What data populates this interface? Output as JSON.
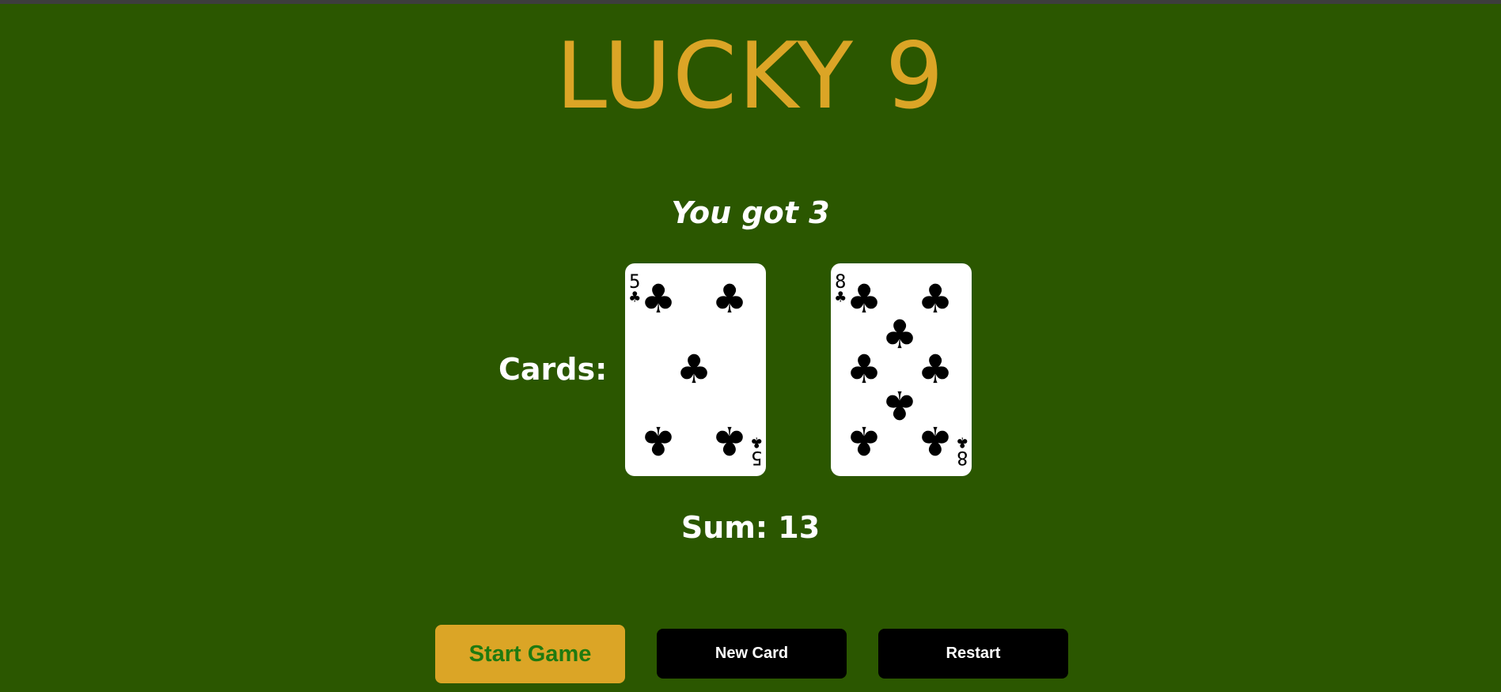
{
  "game": {
    "title": "LUCKY 9",
    "message": "You got 3",
    "cards_label": "Cards:",
    "sum_text": "Sum: 13"
  },
  "cards": [
    {
      "rank": "5",
      "suit": "clubs",
      "suit_glyph": "♣"
    },
    {
      "rank": "8",
      "suit": "clubs",
      "suit_glyph": "♣"
    }
  ],
  "buttons": {
    "start": "Start Game",
    "new_card": "New Card",
    "restart": "Restart"
  },
  "colors": {
    "table": "#2b5700",
    "gold": "#dba526",
    "start_text": "#1f7a10"
  }
}
